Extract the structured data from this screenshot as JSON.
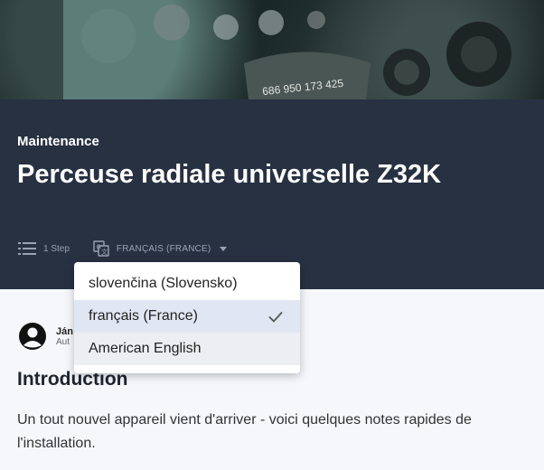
{
  "hero": {
    "plate_text": "686 950 173 425"
  },
  "guide": {
    "category": "Maintenance",
    "title": "Perceuse radiale universelle Z32K",
    "steps": "1 Step",
    "language": "Français (France)"
  },
  "author": {
    "name": "Ján",
    "role": "Aut"
  },
  "language_menu": {
    "options": [
      {
        "label": "slovenčina (Slovensko)"
      },
      {
        "label": "français (France)",
        "selected": true
      },
      {
        "label": "American English"
      }
    ]
  },
  "content": {
    "section_title": "Introduction",
    "intro_text": "Un tout nouvel appareil vient d'arriver - voici quelques notes rapides de l'installation."
  }
}
